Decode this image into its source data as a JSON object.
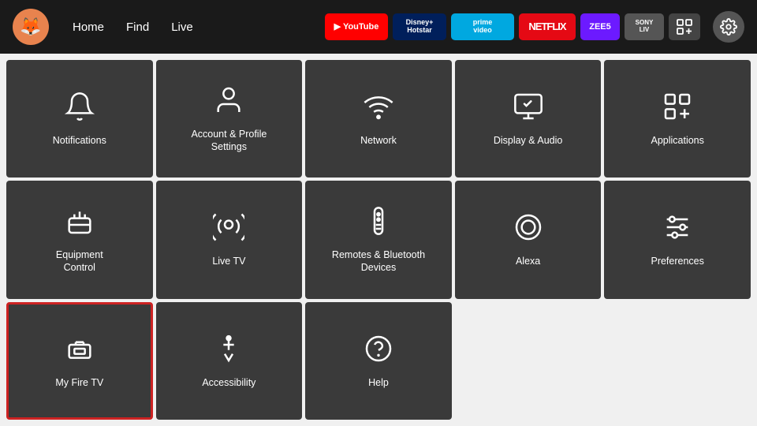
{
  "navbar": {
    "logo_emoji": "🦊",
    "links": [
      "Home",
      "Find",
      "Live"
    ],
    "apps": [
      {
        "name": "YouTube",
        "class": "app-badge-youtube",
        "text": "▶ YouTube"
      },
      {
        "name": "Disney+ Hotstar",
        "class": "app-badge-disney",
        "text": "Disney+\nHotstar"
      },
      {
        "name": "Prime Video",
        "class": "app-badge-prime",
        "text": "prime\nvideo"
      },
      {
        "name": "Netflix",
        "class": "app-badge-netflix",
        "text": "NETFLIX"
      },
      {
        "name": "ZEE5",
        "class": "app-badge-zee5",
        "text": "ZEE5"
      },
      {
        "name": "Sony LIV",
        "class": "app-badge-sony",
        "text": "SONY\nLIV"
      },
      {
        "name": "Apps Icon",
        "class": "app-badge-icon",
        "text": "⊞"
      }
    ],
    "settings_icon": "⚙"
  },
  "grid": {
    "tiles": [
      {
        "id": "notifications",
        "label": "Notifications",
        "icon": "bell",
        "selected": false
      },
      {
        "id": "account",
        "label": "Account & Profile Settings",
        "icon": "person",
        "selected": false
      },
      {
        "id": "network",
        "label": "Network",
        "icon": "wifi",
        "selected": false
      },
      {
        "id": "display-audio",
        "label": "Display & Audio",
        "icon": "display",
        "selected": false
      },
      {
        "id": "applications",
        "label": "Applications",
        "icon": "apps-grid",
        "selected": false
      },
      {
        "id": "equipment",
        "label": "Equipment Control",
        "icon": "tv-remote",
        "selected": false
      },
      {
        "id": "live-tv",
        "label": "Live TV",
        "icon": "antenna",
        "selected": false
      },
      {
        "id": "remotes",
        "label": "Remotes & Bluetooth Devices",
        "icon": "remote",
        "selected": false
      },
      {
        "id": "alexa",
        "label": "Alexa",
        "icon": "alexa-circle",
        "selected": false
      },
      {
        "id": "preferences",
        "label": "Preferences",
        "icon": "sliders",
        "selected": false
      },
      {
        "id": "my-fire-tv",
        "label": "My Fire TV",
        "icon": "firetv",
        "selected": true
      },
      {
        "id": "accessibility",
        "label": "Accessibility",
        "icon": "accessibility",
        "selected": false
      },
      {
        "id": "help",
        "label": "Help",
        "icon": "question",
        "selected": false
      }
    ]
  }
}
